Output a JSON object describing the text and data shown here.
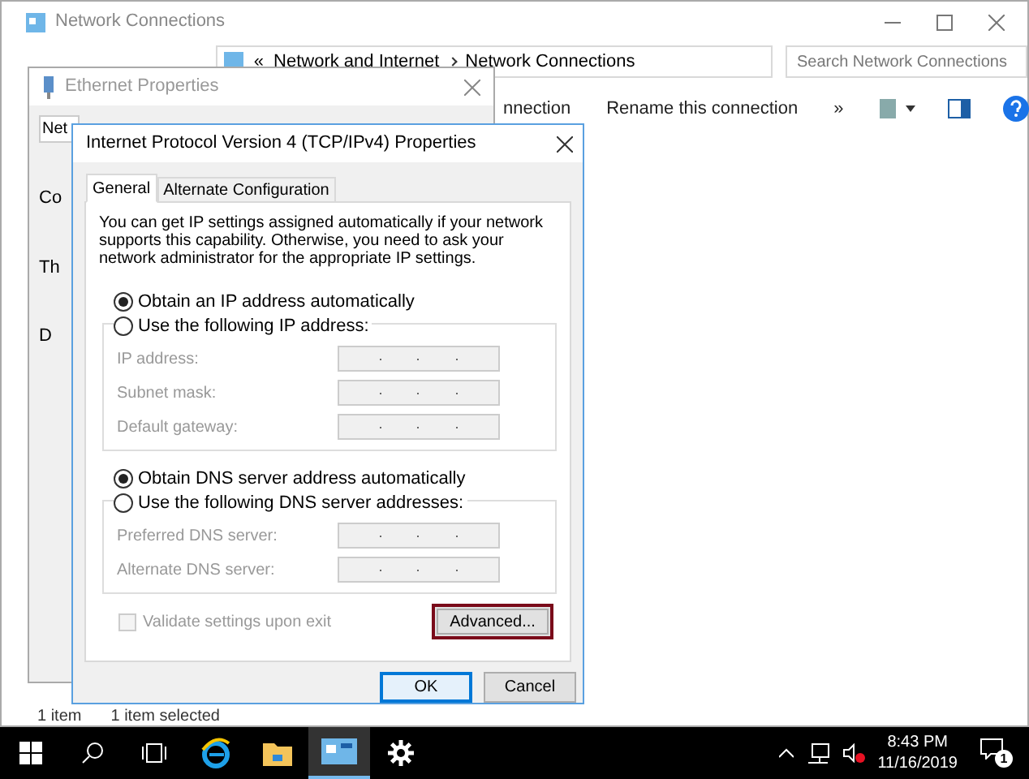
{
  "explorer": {
    "title": "Network Connections",
    "breadcrumb": [
      "«",
      "Network and Internet",
      "Network Connections"
    ],
    "search": {
      "placeholder": "Search Network Connections"
    },
    "toolbar": [
      "nnection",
      "Rename this connection",
      "»"
    ],
    "status_bar": [
      "1 item",
      "1 item selected"
    ]
  },
  "ethernet_window": {
    "title": "Ethernet Properties",
    "tab": "Net",
    "texts": [
      "Co",
      "Th",
      "D"
    ]
  },
  "dialog": {
    "title": "Internet Protocol Version 4 (TCP/IPv4) Properties",
    "tabs": [
      {
        "label": "General",
        "selected": true
      },
      {
        "label": "Alternate Configuration",
        "selected": false
      }
    ],
    "intro": "You can get IP settings assigned automatically if your network supports this capability. Otherwise, you need to ask your network administrator for the appropriate IP settings.",
    "ip_options": [
      {
        "label": "Obtain an IP address automatically",
        "selected": true
      },
      {
        "label": "Use the following IP address:",
        "selected": false
      }
    ],
    "ip_fields": [
      {
        "label": "IP address:",
        "disabled": true
      },
      {
        "label": "Subnet mask:",
        "disabled": true
      },
      {
        "label": "Default gateway:",
        "disabled": true
      }
    ],
    "dns_options": [
      {
        "label": "Obtain DNS server address automatically",
        "selected": true
      },
      {
        "label": "Use the following DNS server addresses:",
        "selected": false
      }
    ],
    "dns_fields": [
      {
        "label": "Preferred DNS server:",
        "disabled": true
      },
      {
        "label": "Alternate DNS server:",
        "disabled": true
      }
    ],
    "validate": {
      "label": "Validate settings upon exit",
      "checked": false,
      "disabled": true
    },
    "advanced_button": {
      "label": "Advanced...",
      "highlighted": true
    },
    "buttons": [
      {
        "label": "OK",
        "default": true
      },
      {
        "label": "Cancel",
        "default": false
      }
    ]
  },
  "taskbar": {
    "apps": [
      {
        "kind": "browser",
        "active": false
      },
      {
        "kind": "folder",
        "active": false
      },
      {
        "kind": "network",
        "active": true
      },
      {
        "kind": "settings",
        "active": false
      }
    ],
    "time": "8:43 PM",
    "date": "11/16/2019",
    "notifications": "1"
  }
}
